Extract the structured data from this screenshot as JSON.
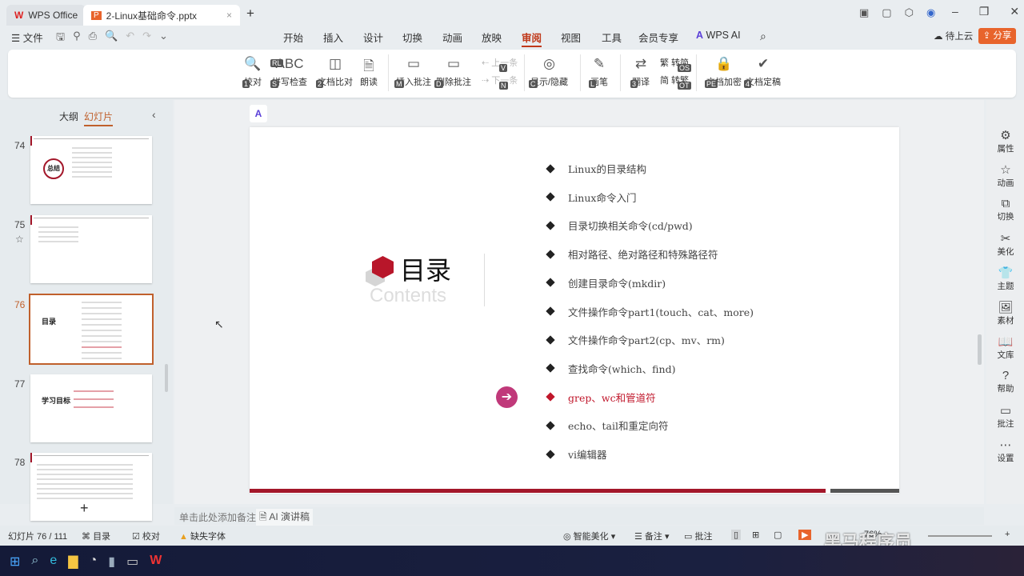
{
  "tabs": [
    {
      "label": "WPS Office"
    },
    {
      "label": "2-Linux基础命令.pptx"
    }
  ],
  "menu": {
    "file": "文件",
    "tabs": [
      "开始",
      "插入",
      "设计",
      "切换",
      "动画",
      "放映",
      "审阅",
      "视图",
      "工具",
      "会员专享"
    ],
    "active": "审阅",
    "wps_ai": "WPS AI",
    "cloud": "待上云",
    "share": "分享"
  },
  "ribbon": [
    {
      "label": "校对",
      "key": "1"
    },
    {
      "label": "拼写检查",
      "key": "S",
      "key2": "RL"
    },
    {
      "label": "文档比对",
      "key": "2"
    },
    {
      "label": "朗读"
    },
    {
      "label": "插入批注",
      "key": "M"
    },
    {
      "label": "删除批注",
      "key": "D"
    },
    {
      "label": "上一条",
      "key": "V"
    },
    {
      "label": "下一条",
      "key": "N"
    },
    {
      "label": "显示/隐藏",
      "key": "C"
    },
    {
      "label": "画笔",
      "key": "L"
    },
    {
      "label": "翻译",
      "key": "3"
    },
    {
      "label": "转简",
      "key": "OS"
    },
    {
      "label": "转繁",
      "key": "OT"
    },
    {
      "label": "文档加密",
      "key": "PE"
    },
    {
      "label": "文档定稿",
      "key": "4"
    }
  ],
  "panel": {
    "outline": "大纲",
    "slides": "幻灯片",
    "thumbs": [
      {
        "n": "74",
        "text": "总结"
      },
      {
        "n": "75",
        "text": ""
      },
      {
        "n": "76",
        "text": "目录"
      },
      {
        "n": "77",
        "text": "学习目标"
      },
      {
        "n": "78",
        "text": ""
      }
    ]
  },
  "slide": {
    "title": "目录",
    "subtitle": "Contents",
    "items": [
      "Linux的目录结构",
      "Linux命令入门",
      "目录切换相关命令(cd/pwd)",
      "相对路径、绝对路径和特殊路径符",
      "创建目录命令(mkdir)",
      "文件操作命令part1(touch、cat、more)",
      "文件操作命令part2(cp、mv、rm)",
      "查找命令(which、find)",
      "grep、wc和管道符",
      "echo、tail和重定向符",
      "vi编辑器"
    ],
    "current_index": 8,
    "accent": "#c0172b"
  },
  "notes": {
    "placeholder": "单击此处添加备注",
    "ai": "AI 演讲稿"
  },
  "sidebar": [
    "属性",
    "动画",
    "切换",
    "美化",
    "主题",
    "素材",
    "文库",
    "帮助",
    "批注",
    "设置"
  ],
  "status": {
    "slide": "幻灯片 76 / 111",
    "outline": "目录",
    "proof": "校对",
    "font": "缺失字体",
    "beautify": "智能美化",
    "notes": "备注",
    "comment": "批注",
    "zoom": "76%"
  },
  "watermark": "黑马程序员"
}
